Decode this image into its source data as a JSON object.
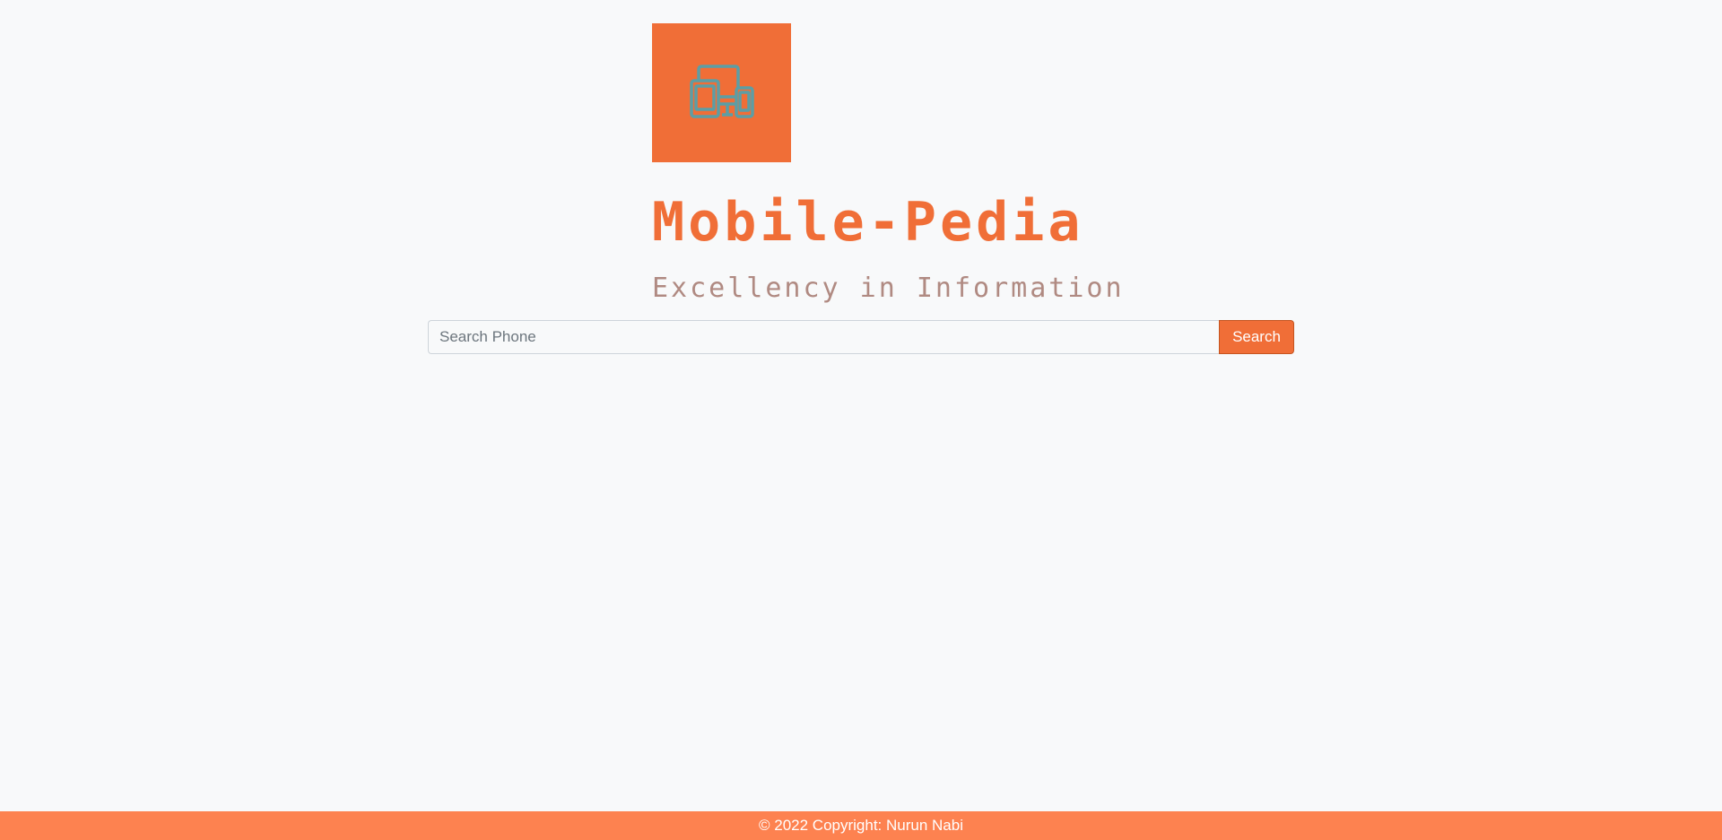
{
  "header": {
    "logo_icon": "devices-icon",
    "logo_bg_color": "#f06e37",
    "logo_icon_color": "#5c9ea5",
    "title": "Mobile-Pedia",
    "subtitle": "Excellency in Information"
  },
  "search": {
    "placeholder": "Search Phone",
    "value": "",
    "button_label": "Search"
  },
  "footer": {
    "text": "© 2022 Copyright: Nurun Nabi"
  },
  "colors": {
    "accent": "#f06e37",
    "footer_bg": "#fd8250",
    "subtitle": "#b08a82",
    "background": "#f8f9fa"
  }
}
